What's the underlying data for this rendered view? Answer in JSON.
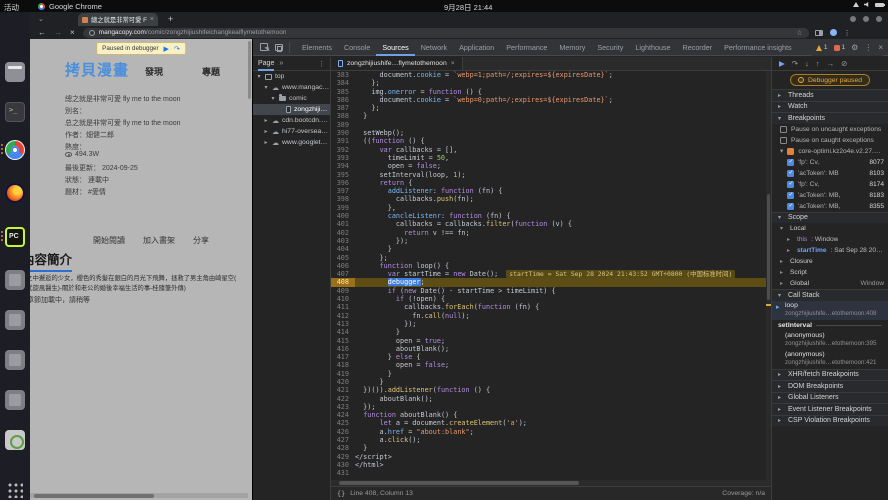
{
  "desktop": {
    "activities": "活动",
    "window_title": "Google Chrome",
    "clock": "9月28日 21:44",
    "dock": [
      {
        "name": "files"
      },
      {
        "name": "terminal"
      },
      {
        "name": "chrome",
        "active": true
      },
      {
        "name": "firefox"
      },
      {
        "name": "pycharm",
        "active": true
      },
      {
        "name": "app-1"
      },
      {
        "name": "app-2"
      },
      {
        "name": "app-3"
      },
      {
        "name": "app-4"
      },
      {
        "name": "software-center"
      },
      {
        "name": "app-grid"
      }
    ]
  },
  "browser": {
    "tab_title": "總之就是非常可愛 Fly m",
    "tab_close": "×",
    "new_tab": "+",
    "url_host": "mangacopy.com",
    "url_path": "/comic/zongzhijiushifeichangkeaiflymetothemoon"
  },
  "page": {
    "paused_banner": "Paused in debugger",
    "logo": "拷貝漫畫",
    "nav": [
      "發現",
      "專題"
    ],
    "info": [
      {
        "text": "總之就是非常可愛 fly me to the moon"
      },
      {
        "text": "別名："
      },
      {
        "text": "总之就是非常可爱 fly me to the moon"
      },
      {
        "text": "作者：畑健二郎"
      },
      {
        "text": "熱度："
      },
      {
        "text": "494.3W",
        "icon": "eye-icon"
      },
      {
        "text": "最後更新： 2024-09-25"
      },
      {
        "text": "狀態： 連載中"
      },
      {
        "text": "題材： #愛情"
      }
    ],
    "actions": [
      "開始閱讀",
      "加入書架",
      "分享"
    ],
    "section_title": "內容簡介",
    "description": [
      "冬之中邂逅的少女，櫻色的秀髮在銀白的月光下飛舞，拯救了男主角由崎星空(",
      "氣式旋風醫生)-關於和老公的婚後幸福生活的事-桂隨筆外傳)"
    ],
    "loading": "章節加載中，請稍等"
  },
  "devtools": {
    "tabs": [
      "Elements",
      "Console",
      "Sources",
      "Network",
      "Application",
      "Performance",
      "Memory",
      "Security",
      "Lighthouse",
      "Recorder",
      "Performance insights"
    ],
    "active_tab": 2,
    "badges": {
      "warnings": "1",
      "issues": "1"
    },
    "navigator": {
      "panel_tab": "Page",
      "more": "»",
      "kebab": "⋮",
      "tree": [
        {
          "label": "top",
          "depth": 0,
          "icon": "frame",
          "exp": true
        },
        {
          "label": "www.mangacopy..",
          "depth": 1,
          "icon": "cloud",
          "exp": true
        },
        {
          "label": "comic",
          "depth": 2,
          "icon": "folder",
          "exp": true
        },
        {
          "label": "zongzhijiushif",
          "depth": 3,
          "icon": "file",
          "selected": true
        },
        {
          "label": "cdn.bootcdn.net",
          "depth": 1,
          "icon": "cloud",
          "exp": false
        },
        {
          "label": "hi77-overseas.ma..",
          "depth": 1,
          "icon": "cloud",
          "exp": false
        },
        {
          "label": "www.googletagm...",
          "depth": 1,
          "icon": "cloud",
          "exp": false
        }
      ]
    },
    "editor": {
      "tab_title": "zongzhijiushife…flymetothemoon",
      "tab_close": "×",
      "paused_line": 408,
      "hint_line": 407,
      "hint": "startTime = Sat Sep 28 2024 21:43:52 GMT+0800 (中国标准时间)",
      "status_left": "Line 408, Column 13",
      "status_right": "Coverage: n/a",
      "lines": [
        {
          "n": 383,
          "t": "      document.cookie = `webp=1;path=/;expires=${expiresDate}`;"
        },
        {
          "n": 384,
          "t": "    };"
        },
        {
          "n": 385,
          "t": "    img.onerror = function () {"
        },
        {
          "n": 386,
          "t": "      document.cookie = `webp=0;path=/;expires=${expiresDate}`;"
        },
        {
          "n": 387,
          "t": "    };"
        },
        {
          "n": 388,
          "t": "  }"
        },
        {
          "n": 389,
          "t": ""
        },
        {
          "n": 390,
          "t": "  setWebp();"
        },
        {
          "n": 391,
          "t": "  ((function () {"
        },
        {
          "n": 392,
          "t": "      var callbacks = [],"
        },
        {
          "n": 393,
          "t": "        timeLimit = 50,"
        },
        {
          "n": 394,
          "t": "        open = false;"
        },
        {
          "n": 395,
          "t": "      setInterval(loop, 1);"
        },
        {
          "n": 396,
          "t": "      return {"
        },
        {
          "n": 397,
          "t": "        addListener: function (fn) {"
        },
        {
          "n": 398,
          "t": "          callbacks.push(fn);"
        },
        {
          "n": 399,
          "t": "        },"
        },
        {
          "n": 400,
          "t": "        cancleListenr: function (fn) {"
        },
        {
          "n": 401,
          "t": "          callbacks = callbacks.filter(function (v) {"
        },
        {
          "n": 402,
          "t": "            return v !== fn;"
        },
        {
          "n": 403,
          "t": "          });"
        },
        {
          "n": 404,
          "t": "        }"
        },
        {
          "n": 405,
          "t": "      };"
        },
        {
          "n": 406,
          "t": "      function loop() {"
        },
        {
          "n": 407,
          "t": "        var startTime = new Date();"
        },
        {
          "n": 408,
          "t": "        debugger;"
        },
        {
          "n": 409,
          "t": "        if (new Date() - startTime > timeLimit) {"
        },
        {
          "n": 410,
          "t": "          if (!open) {"
        },
        {
          "n": 411,
          "t": "            callbacks.forEach(function (fn) {"
        },
        {
          "n": 412,
          "t": "              fn.call(null);"
        },
        {
          "n": 413,
          "t": "            });"
        },
        {
          "n": 414,
          "t": "          }"
        },
        {
          "n": 415,
          "t": "          open = true;"
        },
        {
          "n": 416,
          "t": "          aboutBlank();"
        },
        {
          "n": 417,
          "t": "        } else {"
        },
        {
          "n": 418,
          "t": "          open = false;"
        },
        {
          "n": 419,
          "t": "        }"
        },
        {
          "n": 420,
          "t": "      }"
        },
        {
          "n": 421,
          "t": "  })()).addListener(function () {"
        },
        {
          "n": 422,
          "t": "      aboutBlank();"
        },
        {
          "n": 423,
          "t": "  });"
        },
        {
          "n": 424,
          "t": "  function aboutBlank() {"
        },
        {
          "n": 425,
          "t": "      let a = document.createElement('a');"
        },
        {
          "n": 426,
          "t": "      a.href = \"about:blank\";"
        },
        {
          "n": 427,
          "t": "      a.click();"
        },
        {
          "n": 428,
          "t": "  }"
        },
        {
          "n": 429,
          "t": "</script>"
        },
        {
          "n": 430,
          "t": "</html>"
        },
        {
          "n": 431,
          "t": ""
        }
      ]
    },
    "side": {
      "paused_label": "Debugger paused",
      "threads": "Threads",
      "watch": "Watch",
      "breakpoints_title": "Breakpoints",
      "pause_options": [
        "Pause on uncaught exceptions",
        "Pause on caught exceptions"
      ],
      "breakpoint_group": "core-optimi.kz2o4e.v2.27.2…",
      "breakpoint_items": [
        {
          "label": "'fp': Cv,",
          "line": "8077"
        },
        {
          "label": "'acToken': MB",
          "line": "8103"
        },
        {
          "label": "'fp': Cv,",
          "line": "8174"
        },
        {
          "label": "'acToken': MB,",
          "line": "8183"
        },
        {
          "label": "'acToken': MB,",
          "line": "8355"
        }
      ],
      "scope_title": "Scope",
      "scope_rows": [
        {
          "label": "Local",
          "exp": true,
          "depth": 0
        },
        {
          "key": "this",
          "value": "Window",
          "depth": 1
        },
        {
          "key": "startTime",
          "value": "Sat Sep 28 2024 21…",
          "depth": 1,
          "highlight": true
        },
        {
          "label": "Closure",
          "exp": false,
          "depth": 0
        },
        {
          "label": "Script",
          "exp": false,
          "depth": 0
        },
        {
          "label": "Global",
          "exp": false,
          "depth": 0,
          "right": "Window"
        }
      ],
      "callstack_title": "Call Stack",
      "frames": [
        {
          "name": "loop",
          "loc": "zongzhijiushife…etothemoon:408",
          "active": true
        },
        {
          "name": "setInterval",
          "divider": true
        },
        {
          "name": "(anonymous)",
          "loc": "zongzhijiushife…etothemoon:395"
        },
        {
          "name": "(anonymous)",
          "loc": "zongzhijiushife…etothemoon:421"
        }
      ],
      "collapsed_sections": [
        "XHR/fetch Breakpoints",
        "DOM Breakpoints",
        "Global Listeners",
        "Event Listener Breakpoints",
        "CSP Violation Breakpoints"
      ]
    }
  }
}
